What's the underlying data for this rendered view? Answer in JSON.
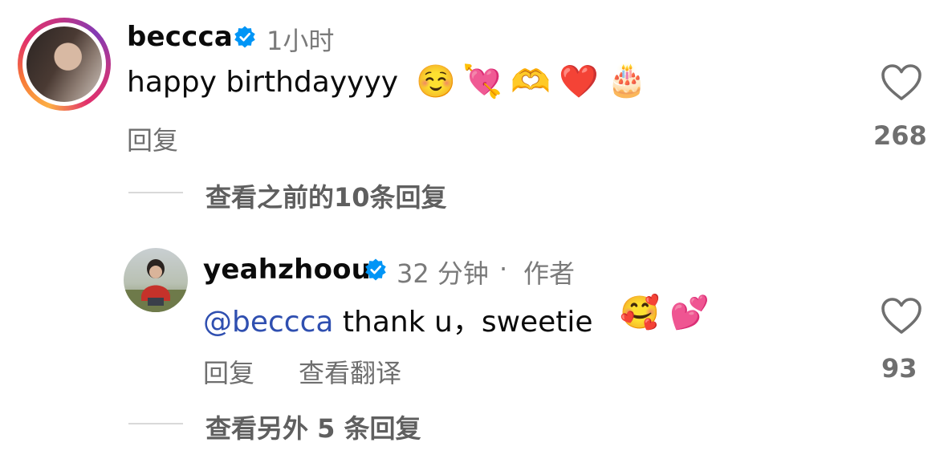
{
  "comment1": {
    "username": "beccca",
    "time": "1小时",
    "text": "happy birthdayyyy",
    "emojis": [
      "☺️",
      "💘",
      "🫶",
      "❤️",
      "🎂"
    ],
    "reply_label": "回复",
    "like_count": "268"
  },
  "replies_toggle1": {
    "label": "查看之前的10条回复"
  },
  "comment2": {
    "username": "yeahzhoou",
    "time": "32 分钟",
    "separator": "·",
    "role": "作者",
    "mention": "@beccca",
    "text": " thank u，sweetie",
    "emojis": [
      "🥰",
      "💕"
    ],
    "reply_label": "回复",
    "translate_label": "查看翻译",
    "like_count": "93"
  },
  "replies_toggle2": {
    "label": "查看另外 5 条回复"
  },
  "colors": {
    "verified_blue": "#0095f6",
    "mention_blue": "#2f4fb0",
    "meta_gray": "#7a7a7a"
  },
  "icons": {
    "verified": "verified-badge-icon",
    "like": "heart-outline-icon"
  }
}
